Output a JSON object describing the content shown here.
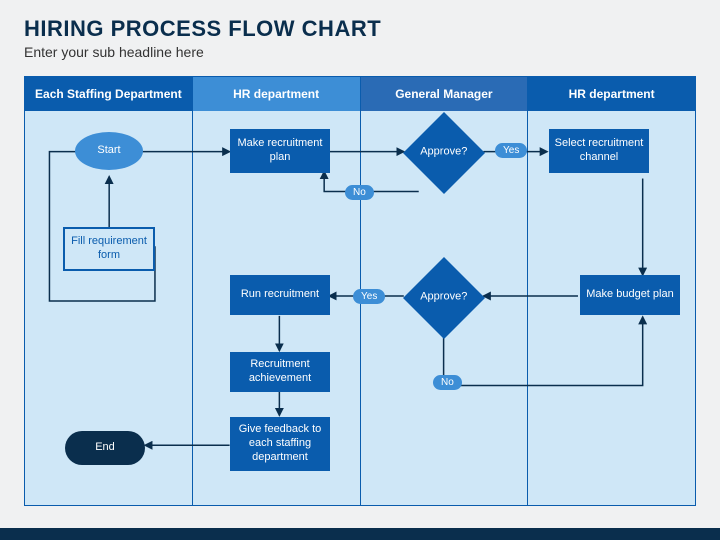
{
  "header": {
    "title": "HIRING PROCESS FLOW CHART",
    "subtitle": "Enter your sub headline here"
  },
  "columns": {
    "c1": "Each Staffing Department",
    "c2": "HR department",
    "c3": "General Manager",
    "c4": "HR department"
  },
  "nodes": {
    "start": "Start",
    "fill": "Fill requirement form",
    "plan": "Make recruitment plan",
    "approve1": "Approve?",
    "select": "Select recruitment channel",
    "run": "Run recruitment",
    "approve2": "Approve?",
    "budget": "Make budget plan",
    "achieve": "Recruitment achievement",
    "feedback": "Give feedback to each staffing department",
    "end": "End"
  },
  "labels": {
    "yes": "Yes",
    "no": "No"
  }
}
